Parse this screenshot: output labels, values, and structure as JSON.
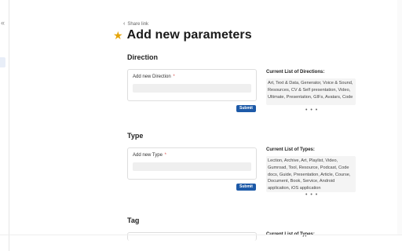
{
  "sidebar": {
    "collapse_icon": "«"
  },
  "breadcrumb": {
    "chevron": "‹",
    "label": "Share link"
  },
  "page": {
    "title": "Add new parameters",
    "title_icon": "star-icon",
    "title_icon_glyph": "★",
    "accent": "#e5a50a"
  },
  "direction": {
    "heading": "Direction",
    "label": "Add new Direction",
    "required": "*",
    "submit": "Submit",
    "list_title": "Current List of Directions:",
    "list_text": "Art, Text & Data, Generator, Voice & Sound, Resources, CV & Self presentation, Video, Ultimate, Presentation, GIFs, Avatars, Code",
    "more": "• • •"
  },
  "type": {
    "heading": "Type",
    "label": "Add new Type",
    "required": "*",
    "submit": "Submit",
    "list_title": "Current List of Types:",
    "list_text": "Lection, Archive, Art, Playlist, Video, Gumroad, Tool, Resource, Podcast, Code docs, Guide, Presentation, Article, Course, Document, Book, Service, Android application, iOS application",
    "more": "• • •"
  },
  "tag": {
    "heading": "Tag",
    "list_title": "Current List of Types:"
  },
  "colors": {
    "button": "#1d5aa8",
    "required": "#d9534f"
  }
}
